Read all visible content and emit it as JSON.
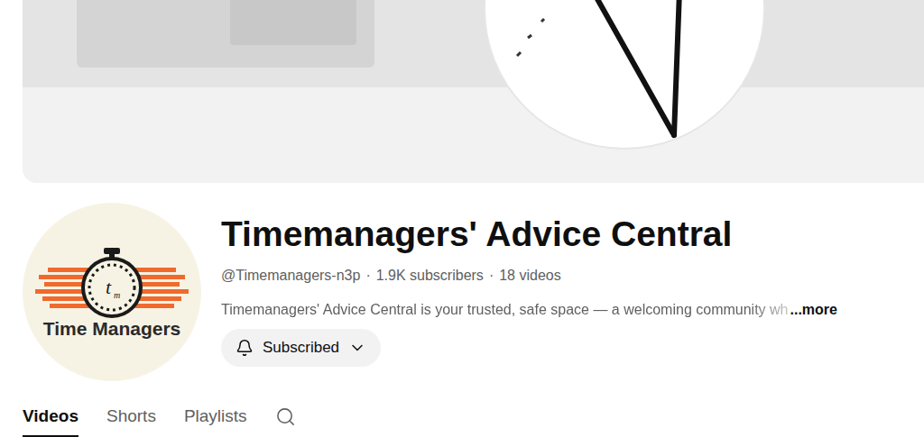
{
  "channel": {
    "name": "Timemanagers' Advice Central",
    "meta": [
      "@Timemanagers-n3p",
      "1.9K subscribers",
      "18 videos"
    ],
    "separator": "·",
    "description": "Timemanagers' Advice Central is your trusted, safe space — a welcoming community wh",
    "more": "...more"
  },
  "avatar": {
    "mark": "t",
    "mark_sub": "m",
    "name": "Time Managers"
  },
  "subscribe_button": {
    "label": "Subscribed",
    "subscribed": true
  },
  "tabs": [
    {
      "label": "Videos",
      "selected": true
    },
    {
      "label": "Shorts",
      "selected": false
    },
    {
      "label": "Playlists",
      "selected": false
    }
  ]
}
